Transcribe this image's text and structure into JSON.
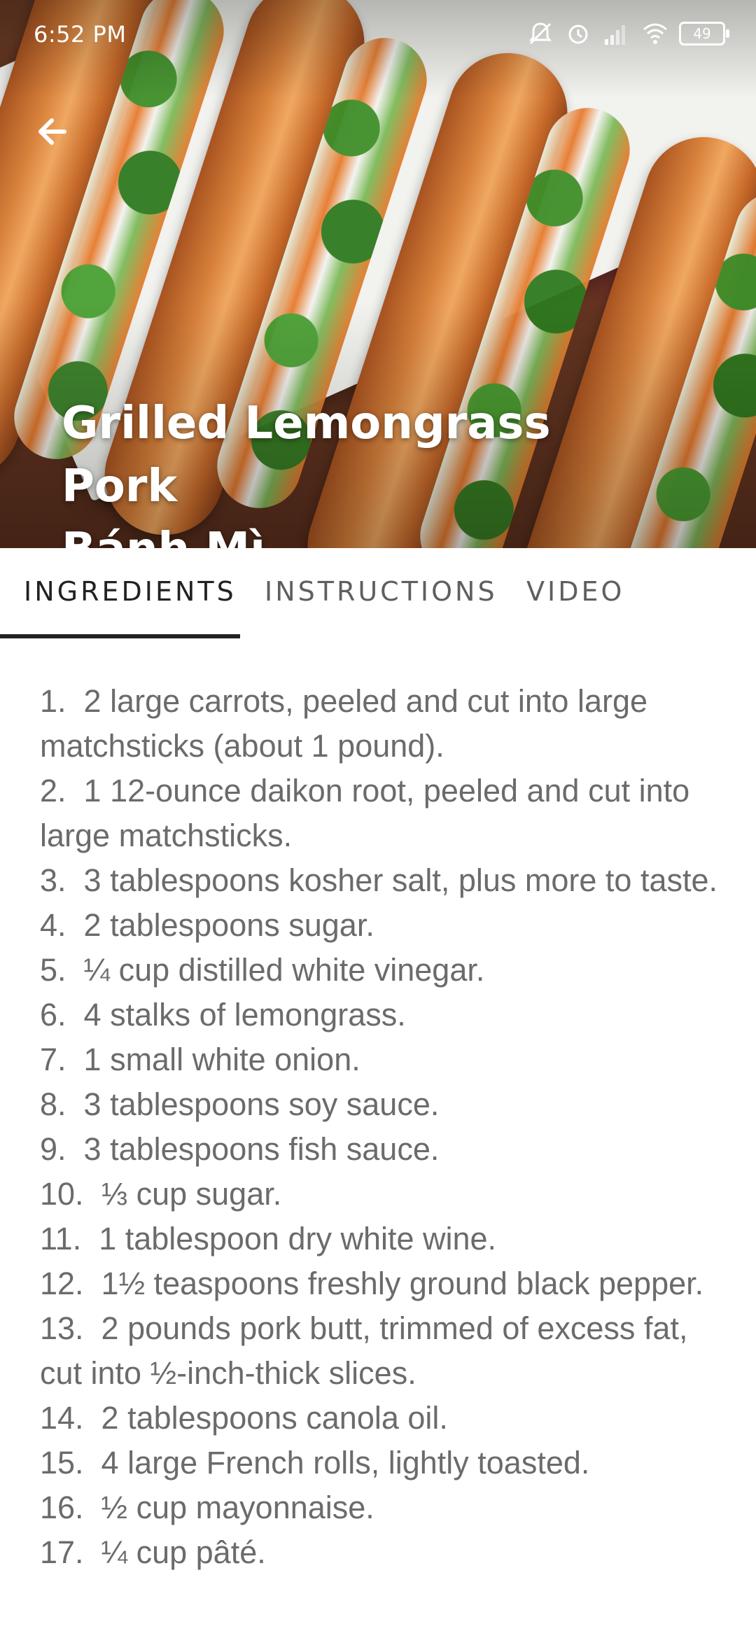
{
  "status_bar": {
    "time": "6:52 PM",
    "battery": "49"
  },
  "header": {
    "back_icon": "arrow-left-icon",
    "title_line1": "Grilled Lemongrass Pork",
    "title_line2": "Bánh Mì"
  },
  "tabs": [
    {
      "label": "INGREDIENTS",
      "active": true
    },
    {
      "label": "INSTRUCTIONS",
      "active": false
    },
    {
      "label": "VIDEO",
      "active": false
    }
  ],
  "ingredients": [
    "1.  2 large carrots, peeled and cut into large matchsticks (about 1 pound).",
    "2.  1 12-ounce daikon root, peeled and cut into large matchsticks.",
    "3.  3 tablespoons kosher salt, plus more to taste.",
    "4.  2 tablespoons sugar.",
    "5.  ¼ cup distilled white vinegar.",
    "6.  4 stalks of lemongrass.",
    "7.  1 small white onion.",
    "8.  3 tablespoons soy sauce.",
    "9.  3 tablespoons fish sauce.",
    "10.  ⅓ cup sugar.",
    "11.  1 tablespoon dry white wine.",
    "12.  1½ teaspoons freshly ground black pepper.",
    "13.  2 pounds pork butt, trimmed of excess fat, cut into ½-inch-thick slices.",
    "14.  2 tablespoons canola oil.",
    "15.  4 large French rolls, lightly toasted.",
    "16.  ½ cup mayonnaise.",
    "17.  ¼ cup pâté."
  ]
}
